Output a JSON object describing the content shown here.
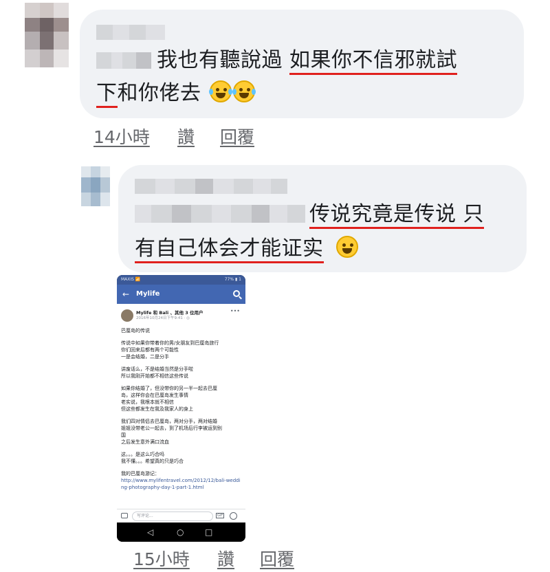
{
  "comment1": {
    "text_plain": "我也有聽說過 ",
    "text_underlined_line1": "如果你不信邪就試",
    "text_underlined_line2": "下",
    "text_line2_rest": "和你佬去",
    "emojis": [
      "joy-emoji",
      "joy-emoji"
    ],
    "time": "14小時",
    "like_label": "讚",
    "reply_label": "回覆"
  },
  "comment2": {
    "text_underlined_line1": "传说究竟是传说 只",
    "text_underlined_line2": "有自己体会才能证实",
    "emojis": [
      "grin-emoji"
    ],
    "time": "15小時",
    "like_label": "讚",
    "reply_label": "回覆"
  },
  "phone": {
    "status_left": "MAXIS 📶",
    "status_right": "77% ▮ 1",
    "appbar_title": "Mylife",
    "post_author": "Mylife 和 Bali 、其他 3 位用户",
    "post_time": "2016年10月24日下午9:41 · ◎",
    "post_paragraphs": [
      "巴厘岛的传说",
      "传说中如果你带着你的男/女朋友到巴厘岛旅行\n你们回来后都有两个可能性\n一是会结婚，二是分手",
      "讲废话么，不是结婚当然是分手啦\n所以我刚开始都不相信这些传说",
      "如果你结婚了，但没带你的另一半一起去巴厘\n岛，这样你会在巴厘岛发生事情\n老实说，我根本就不相信\n但这些都发生在我及我家人的身上",
      "我们四对情侣去巴厘岛，两对分手，两对结婚\n姐姐没带老公一起去，到了机场后行李被运到别\n国\n之后发生意外满口流血",
      "这。。。是这么巧合吗\n我不懂。。。希望真的只是巧合",
      "我的巴厘岛游记："
    ],
    "post_link": "http://www.mylifentravel.com/2012/12/bali-wedding-photography-day-1-part-1.html",
    "comment_placeholder": "写评论...",
    "gif_label": "GIF",
    "nav_back": "◁",
    "nav_home": "○",
    "nav_recent": "□"
  },
  "colors": {
    "bubble": "#f0f2f5",
    "underline": "#e0201d",
    "meta_text": "#65676b",
    "fb_blue": "#4267b2"
  }
}
